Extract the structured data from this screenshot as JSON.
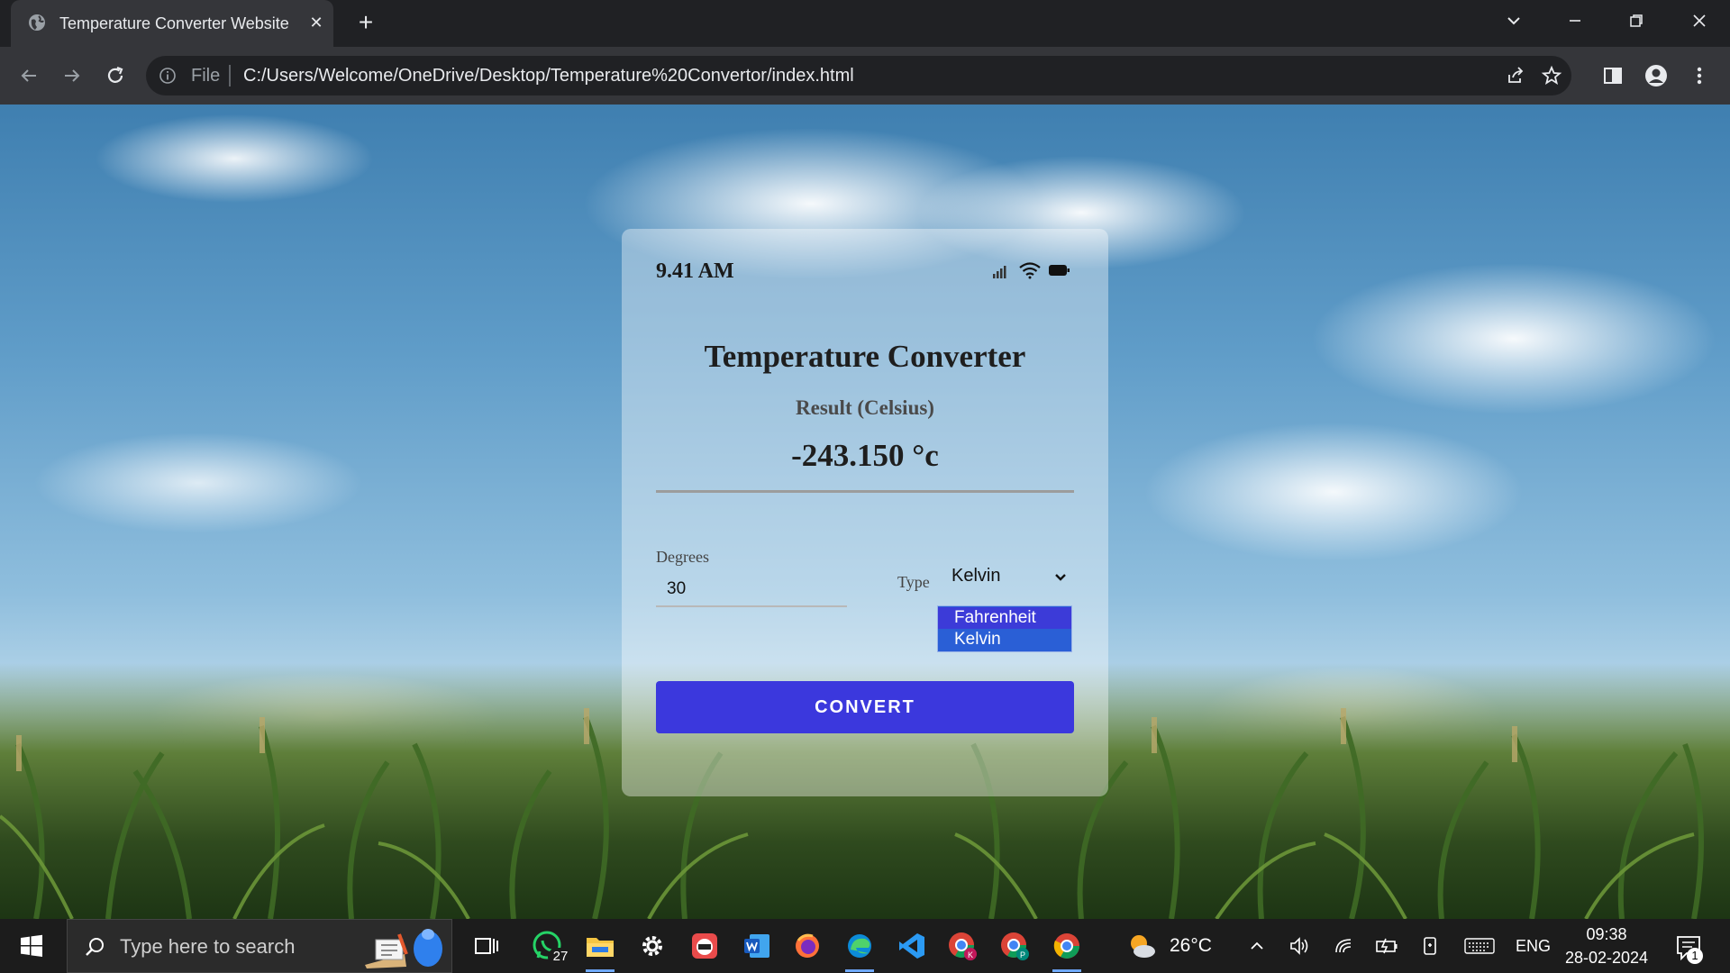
{
  "browser": {
    "tab_title": "Temperature Converter Website",
    "address_scheme": "File",
    "address_url": "C:/Users/Welcome/OneDrive/Desktop/Temperature%20Convertor/index.html"
  },
  "app": {
    "status_time": "9.41 AM",
    "title": "Temperature Converter",
    "result_label": "Result (Celsius)",
    "result_value": "-243.150 °c",
    "degrees_label": "Degrees",
    "degrees_value": "30",
    "type_label": "Type",
    "type_selected": "Kelvin",
    "type_options": [
      "Fahrenheit",
      "Kelvin"
    ],
    "convert_label": "CONVERT",
    "accent_color": "#3b38dd"
  },
  "taskbar": {
    "search_placeholder": "Type here to search",
    "whatsapp_badge": "27",
    "weather_temp": "26°C",
    "language": "ENG",
    "clock_time": "09:38",
    "clock_date": "28-02-2024",
    "notification_count": "1"
  }
}
